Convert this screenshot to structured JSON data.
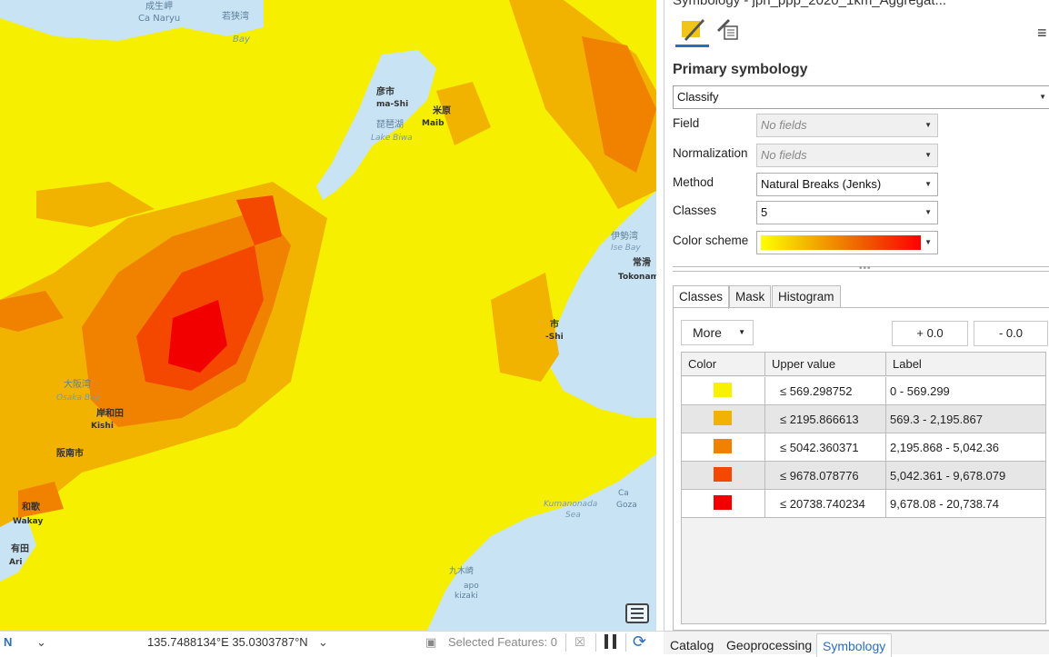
{
  "map": {
    "labels": [
      {
        "id": "label-seiryu",
        "text": "成生岬"
      },
      {
        "id": "label-naryu",
        "text": "Ca  Naryu"
      },
      {
        "id": "label-wakasa",
        "text": "若狭湾"
      },
      {
        "id": "label-bay",
        "text": "Bay"
      },
      {
        "id": "label-hikone",
        "text": "彦市"
      },
      {
        "id": "label-hikone-rom",
        "text": "ma-Shi"
      },
      {
        "id": "label-maibara",
        "text": "米原"
      },
      {
        "id": "label-biwa-jp",
        "text": "琵琶湖"
      },
      {
        "id": "label-maib",
        "text": "Maib"
      },
      {
        "id": "label-biwa",
        "text": "Lake Biwa"
      },
      {
        "id": "label-ise-jp",
        "text": "伊勢湾"
      },
      {
        "id": "label-ise",
        "text": "Ise Bay"
      },
      {
        "id": "label-tokoname-jp",
        "text": "常滑"
      },
      {
        "id": "label-tokoname",
        "text": "Tokonam"
      },
      {
        "id": "label-osaka-jp",
        "text": "大阪湾"
      },
      {
        "id": "label-osaka",
        "text": "Osaka Bay"
      },
      {
        "id": "label-kishiwada-jp",
        "text": "岸和田"
      },
      {
        "id": "label-kishi",
        "text": "Kishi"
      },
      {
        "id": "label-hannan",
        "text": "阪南市"
      },
      {
        "id": "label-wakay-jp",
        "text": "和歌"
      },
      {
        "id": "label-wakay",
        "text": "Wakay"
      },
      {
        "id": "label-arida-jp",
        "text": "有田"
      },
      {
        "id": "label-ari",
        "text": "Ari"
      },
      {
        "id": "label-mie-jp",
        "text": "市"
      },
      {
        "id": "label-mie",
        "text": "-Shi"
      },
      {
        "id": "label-kumano",
        "text": "Kumanonada"
      },
      {
        "id": "label-sea",
        "text": "Sea"
      },
      {
        "id": "label-goza-c",
        "text": "Ca"
      },
      {
        "id": "label-goza",
        "text": "Goza"
      },
      {
        "id": "label-kukizaki-jp",
        "text": "九木崎"
      },
      {
        "id": "label-apo",
        "text": "apo"
      },
      {
        "id": "label-kizaki",
        "text": "kizaki"
      }
    ]
  },
  "statusbar": {
    "nav_glyph": "N",
    "dropdown_glyph": "⌄",
    "coordinates": "135.7488134°E 35.0303787°N",
    "coord_dropdown": "⌄",
    "selected_features": "Selected Features: 0"
  },
  "pane": {
    "title": "Symbology - jpn_ppp_2020_1km_Aggregat...",
    "section_title": "Primary symbology",
    "renderer": "Classify",
    "field_label": "Field",
    "field_value": "No fields",
    "normalization_label": "Normalization",
    "normalization_value": "No fields",
    "method_label": "Method",
    "method_value": "Natural Breaks (Jenks)",
    "classes_label": "Classes",
    "classes_value": "5",
    "color_scheme_label": "Color scheme",
    "color_scheme": [
      "#ffff00",
      "#f4c000",
      "#f08000",
      "#f24000",
      "#ff0000"
    ],
    "tabs": [
      "Classes",
      "Mask",
      "Histogram"
    ],
    "more_label": "More",
    "plus_label": "+ 0.0",
    "minus_label": "- 0.0",
    "table": {
      "headers": [
        "Color",
        "Upper value",
        "Label"
      ],
      "rows": [
        {
          "color": "#f7f200",
          "op": "≤",
          "upper": "569.298752",
          "label": "0 - 569.299"
        },
        {
          "color": "#f2b200",
          "op": "≤",
          "upper": "2195.866613",
          "label": "569.3 - 2,195.867"
        },
        {
          "color": "#f08200",
          "op": "≤",
          "upper": "5042.360371",
          "label": "2,195.868 - 5,042.36"
        },
        {
          "color": "#f44700",
          "op": "≤",
          "upper": "9678.078776",
          "label": "5,042.361 - 9,678.079"
        },
        {
          "color": "#f20000",
          "op": "≤",
          "upper": "20738.740234",
          "label": "9,678.08 - 20,738.74"
        }
      ]
    }
  },
  "bottom_tabs": [
    "Catalog",
    "Geoprocessing",
    "Symbology"
  ]
}
